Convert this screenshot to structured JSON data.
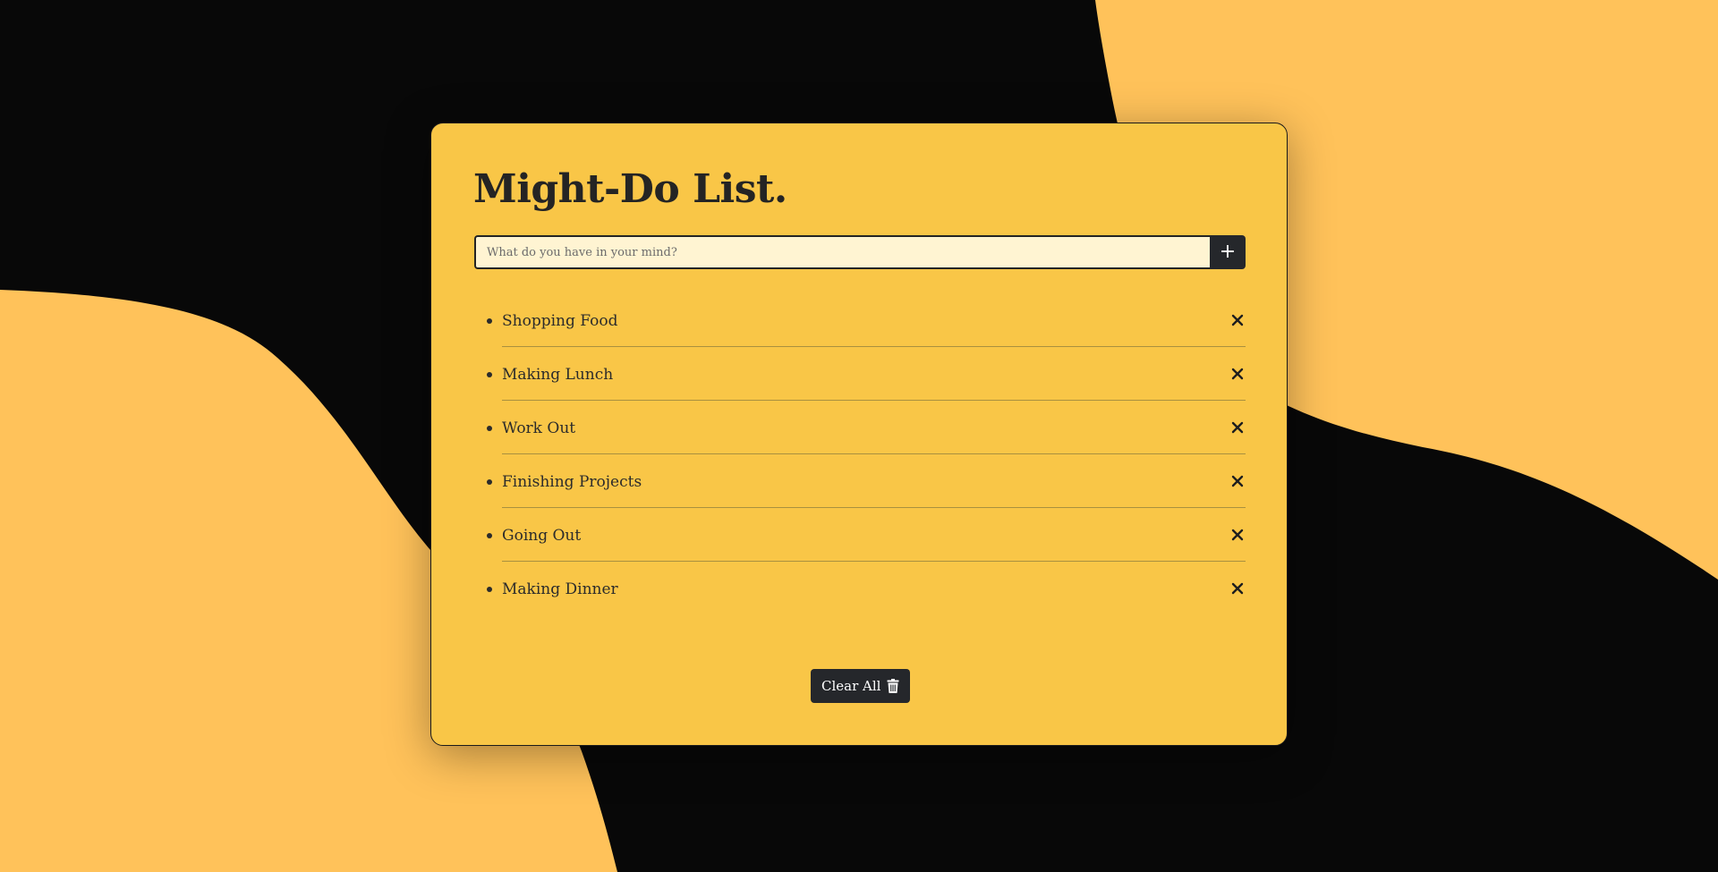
{
  "colors": {
    "background": "#080808",
    "blob": "#ffc25a",
    "card": "#f9c647",
    "dark": "#25272b",
    "input_bg": "#fff4d2"
  },
  "app": {
    "title": "Might-Do List."
  },
  "input": {
    "placeholder": "What do you have in your mind?",
    "value": ""
  },
  "add_button": {
    "icon": "plus-icon",
    "label": "+"
  },
  "tasks": [
    {
      "label": "Shopping Food",
      "delete_icon": "close-icon"
    },
    {
      "label": "Making Lunch",
      "delete_icon": "close-icon"
    },
    {
      "label": "Work Out",
      "delete_icon": "close-icon"
    },
    {
      "label": "Finishing Projects",
      "delete_icon": "close-icon"
    },
    {
      "label": "Going Out",
      "delete_icon": "close-icon"
    },
    {
      "label": "Making Dinner",
      "delete_icon": "close-icon"
    }
  ],
  "clear_button": {
    "label": "Clear All",
    "icon": "trash-icon"
  }
}
